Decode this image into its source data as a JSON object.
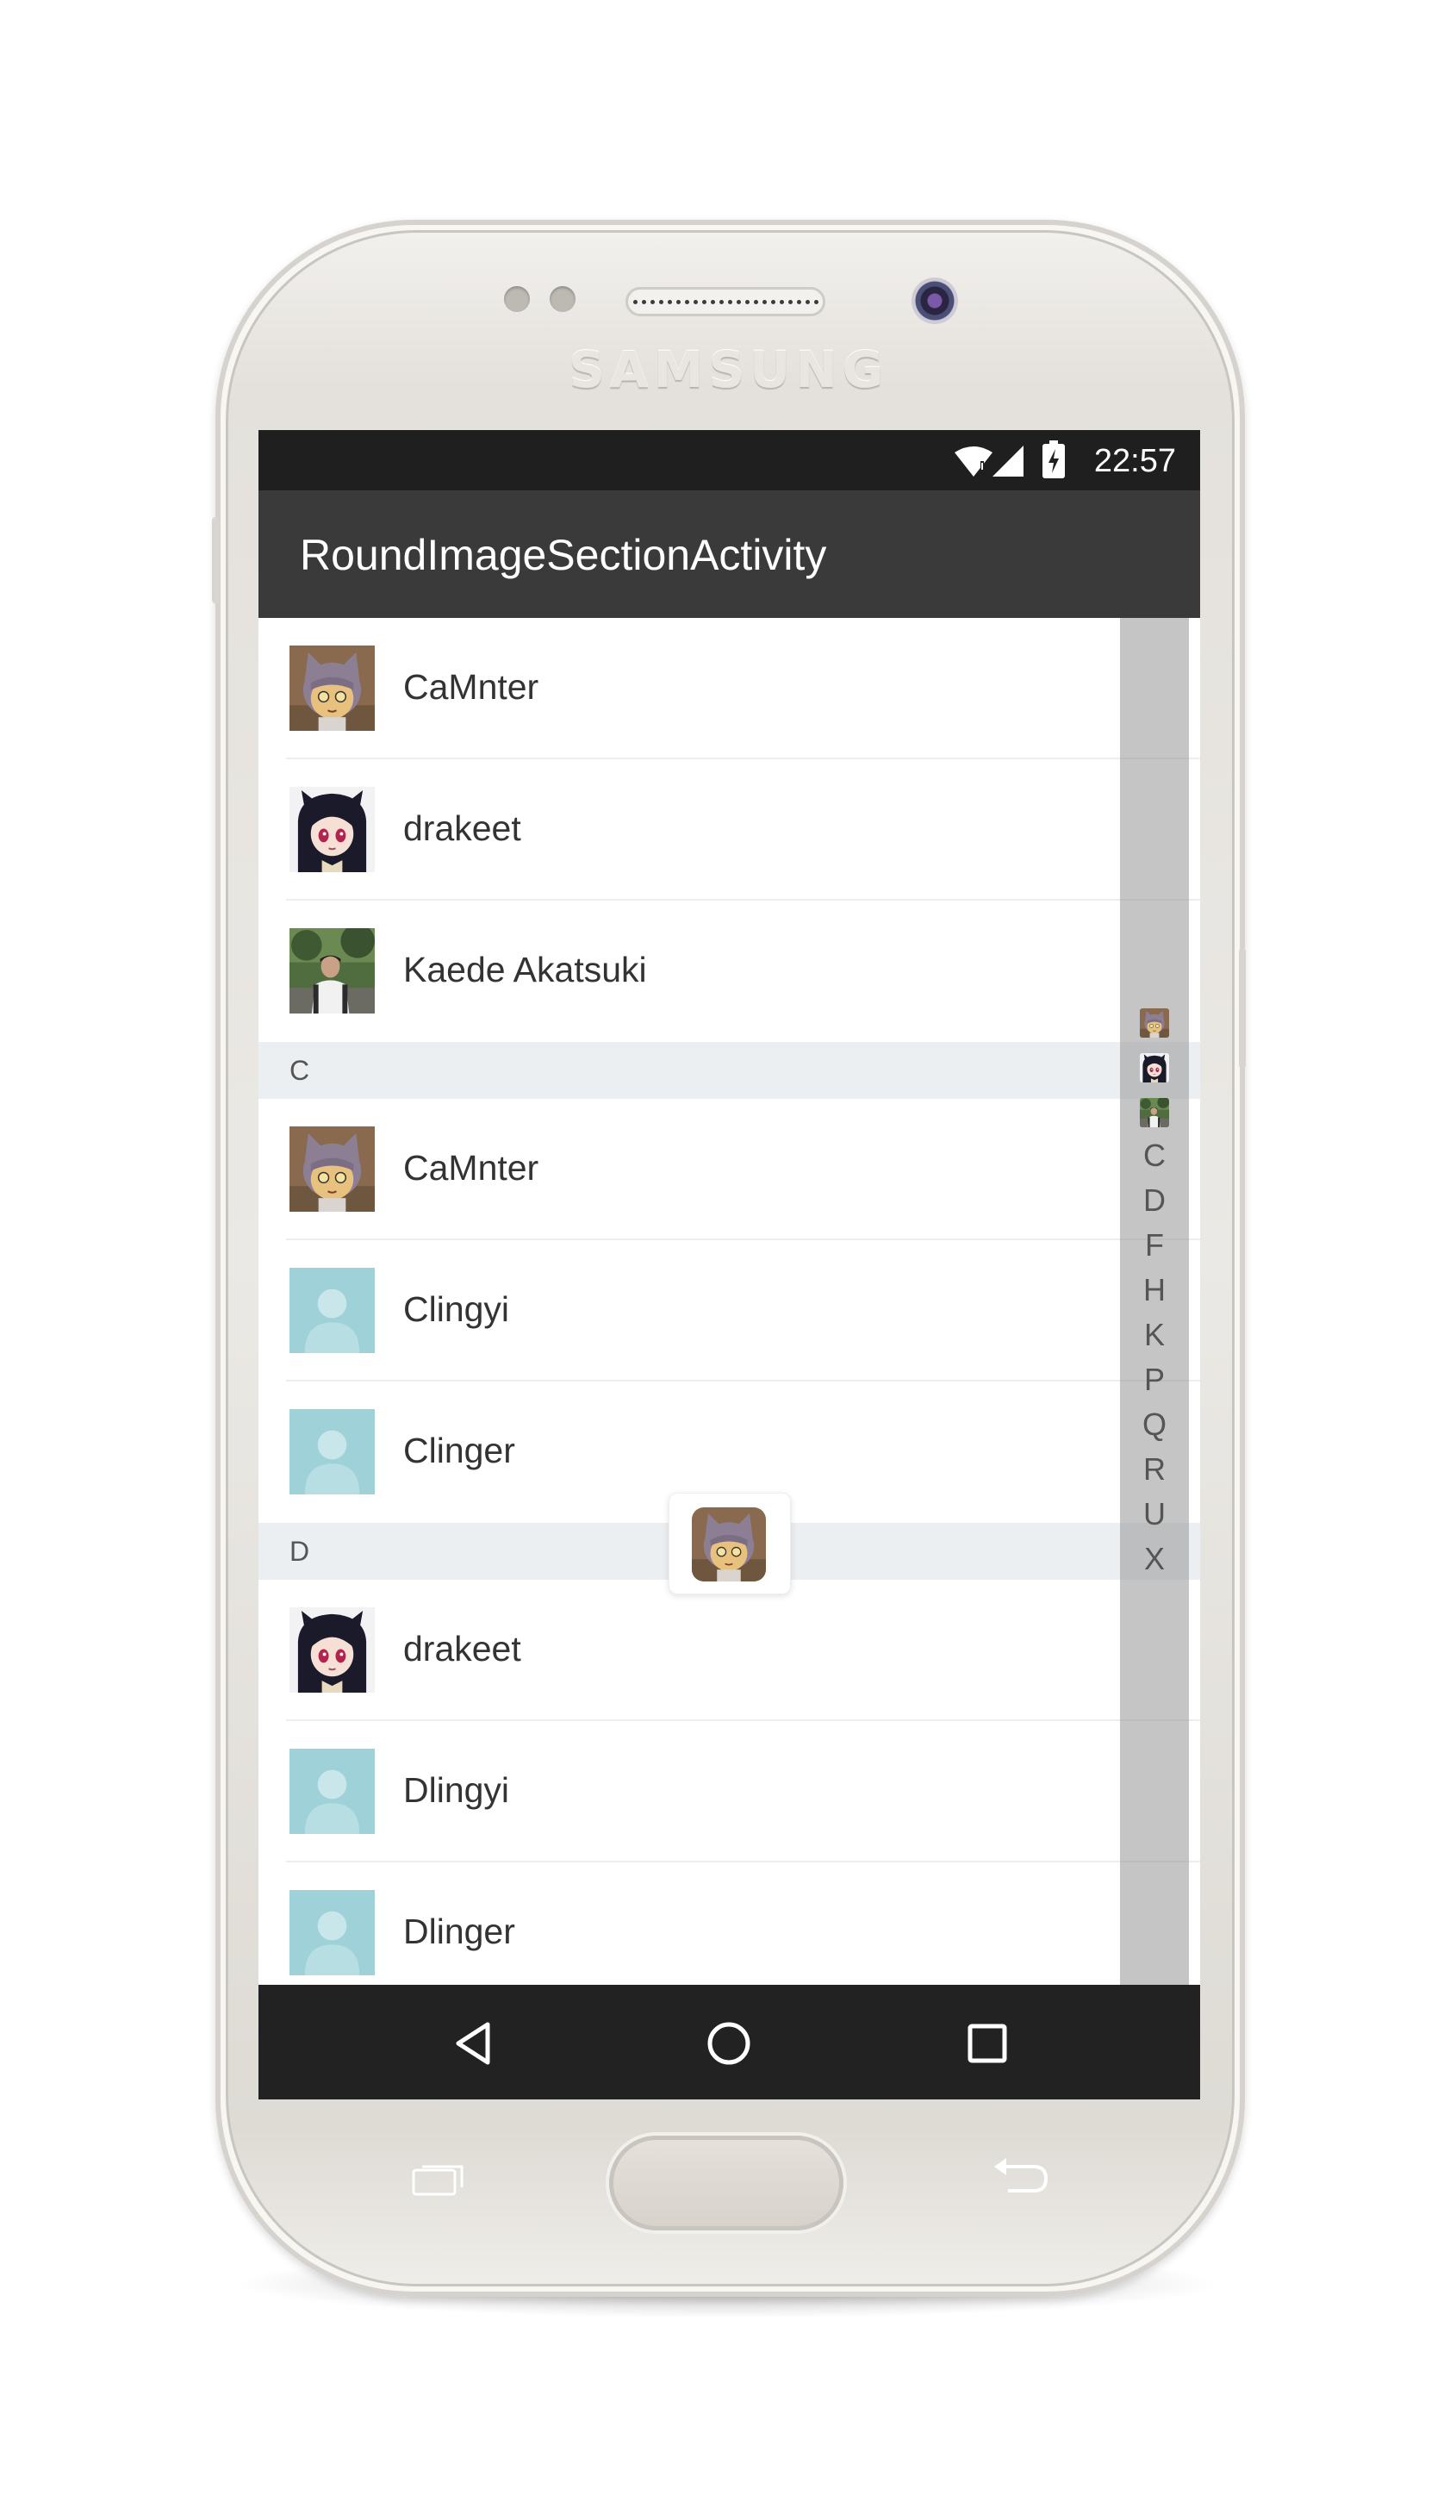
{
  "device": {
    "brand": "SAMSUNG"
  },
  "status_bar": {
    "time": "22:57",
    "icons": [
      "wifi-icon",
      "signal-icon",
      "battery-charging-icon"
    ]
  },
  "toolbar": {
    "title": "RoundImageSectionActivity"
  },
  "list": {
    "top_rows": [
      {
        "name": "CaMnter",
        "avatar": "cat-girl-avatar"
      },
      {
        "name": "drakeet",
        "avatar": "dark-hair-girl-avatar"
      },
      {
        "name": "Kaede Akatsuki",
        "avatar": "photo-person-avatar"
      }
    ],
    "sections": [
      {
        "letter": "C",
        "rows": [
          {
            "name": "CaMnter",
            "avatar": "cat-girl-avatar"
          },
          {
            "name": "Clingyi",
            "avatar": "default-person-avatar"
          },
          {
            "name": "Clinger",
            "avatar": "default-person-avatar"
          }
        ]
      },
      {
        "letter": "D",
        "rows": [
          {
            "name": "drakeet",
            "avatar": "dark-hair-girl-avatar"
          },
          {
            "name": "Dlingyi",
            "avatar": "default-person-avatar"
          },
          {
            "name": "Dlinger",
            "avatar": "default-person-avatar"
          }
        ]
      }
    ]
  },
  "side_index": {
    "avatars": [
      "cat-girl-avatar",
      "dark-hair-girl-avatar",
      "photo-person-avatar"
    ],
    "letters": [
      "C",
      "D",
      "F",
      "H",
      "K",
      "P",
      "Q",
      "R",
      "U",
      "X"
    ]
  },
  "selected_index_overlay": {
    "avatar": "cat-girl-avatar"
  },
  "nav_bar": {
    "buttons": [
      "back-icon",
      "home-icon",
      "recents-icon"
    ]
  }
}
